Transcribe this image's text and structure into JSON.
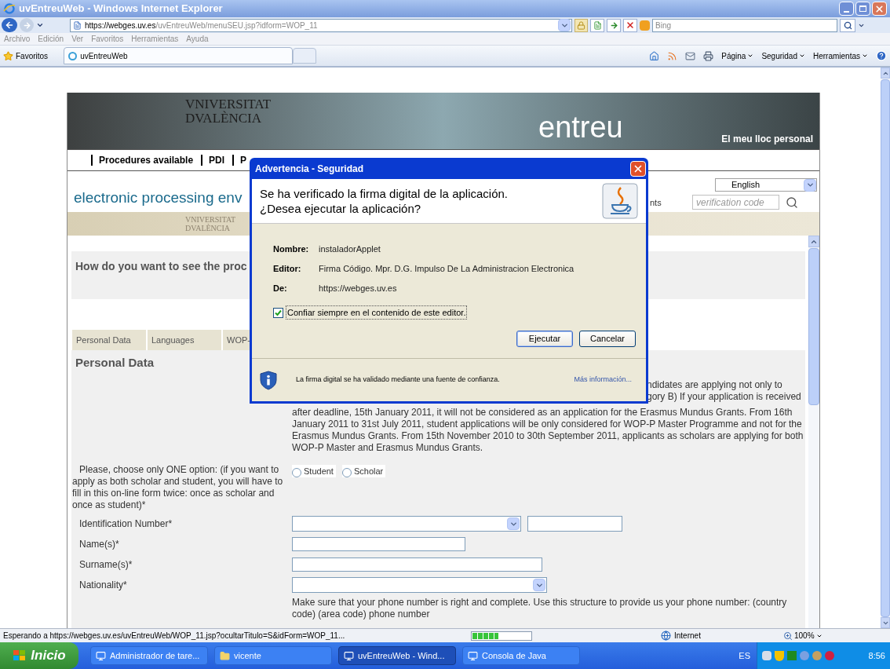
{
  "window": {
    "title": "uvEntreuWeb - Windows Internet Explorer"
  },
  "address_bar": {
    "url_host": "https://webges.uv.es",
    "url_path": "/uvEntreuWeb/menuSEU.jsp?idform=WOP_11",
    "search_placeholder": "Bing"
  },
  "menu": [
    "Archivo",
    "Edición",
    "Ver",
    "Favoritos",
    "Herramientas",
    "Ayuda"
  ],
  "favorites_bar": {
    "label": "Favoritos",
    "tab": "uvEntreuWeb",
    "commands": [
      "Página",
      "Seguridad",
      "Herramientas"
    ]
  },
  "page": {
    "banner": {
      "university": [
        "VNIVERSITAT",
        "DVALÈNCIA"
      ],
      "logo": "entreu",
      "tagline": "El meu lloc personal"
    },
    "nav": [
      "Procedures available",
      "PDI",
      "P"
    ],
    "heading": "electronic processing env",
    "heading_fragment": "nts",
    "language": "English",
    "verification_placeholder": "verification code",
    "seal_text": [
      "VNIVERSITAT",
      "DVALÈNCIA"
    ],
    "question": "How do you want to see the proc",
    "tabs": [
      "Personal Data",
      "Languages",
      "WOP-"
    ],
    "section_title": "Personal Data",
    "notice_fragments": [
      "ndidates are applying not only to",
      "gory B) If your application is received"
    ],
    "notice": "after deadline, 15th January 2011, it will not be considered as an application for the Erasmus Mundus Grants. From 16th January 2011 to 31st July 2011, student applications will be only considered for WOP-P Master Programme and not for the Erasmus Mundus Grants. From 15th November 2010 to 30th September 2011, applicants as scholars are applying for both WOP-P Master and Erasmus Mundus Grants.",
    "form": [
      {
        "kind": "radio",
        "label": "Please, choose only ONE option: (if you want to apply as both scholar and student, you will have to fill in this on-line form twice: once as scholar and once as student)*",
        "options": [
          {
            "label": "Student",
            "selected": false
          },
          {
            "label": "Scholar",
            "selected": false
          }
        ]
      },
      {
        "kind": "id",
        "label": "Identification Number*"
      },
      {
        "kind": "short",
        "label": "Name(s)*"
      },
      {
        "kind": "long",
        "label": "Surname(s)*"
      },
      {
        "kind": "select",
        "label": "Nationality*"
      },
      {
        "kind": "note",
        "text": "Make sure that your phone number is right and complete. Use this structure to provide us your phone number: (country code) (area code) phone number"
      }
    ]
  },
  "dialog": {
    "title": "Advertencia - Seguridad",
    "message": [
      "Se ha verificado la firma digital de la aplicación.",
      "¿Desea ejecutar la aplicación?"
    ],
    "fields": [
      {
        "label": "Nombre:",
        "value": "instaladorApplet"
      },
      {
        "label": "Editor:",
        "value": "Firma Código. Mpr. D.G. Impulso De La Administracion Electronica"
      },
      {
        "label": "De:",
        "value": "https://webges.uv.es"
      }
    ],
    "always_trust": {
      "label": "Confiar siempre en el contenido de este editor.",
      "checked": true
    },
    "buttons": [
      {
        "label": "Ejecutar",
        "default": true
      },
      {
        "label": "Cancelar",
        "default": false
      }
    ],
    "footer": {
      "text": "La firma digital se ha validado mediante una fuente de confianza.",
      "link": "Más información..."
    }
  },
  "status_bar": {
    "text": "Esperando a https://webges.uv.es/uvEntreuWeb/WOP_11.jsp?ocultarTitulo=S&idForm=WOP_11...",
    "progress": {
      "level": 0.45
    },
    "zone": "Internet",
    "zoom": "100%"
  },
  "taskbar": {
    "start": "Inicio",
    "items": [
      {
        "label": "Administrador de tare...",
        "selected": false
      },
      {
        "label": "vicente",
        "selected": false
      },
      {
        "label": "uvEntreuWeb - Wind...",
        "selected": true
      },
      {
        "label": "Consola de Java",
        "selected": false
      }
    ],
    "language": "ES",
    "clock": "8:56"
  }
}
